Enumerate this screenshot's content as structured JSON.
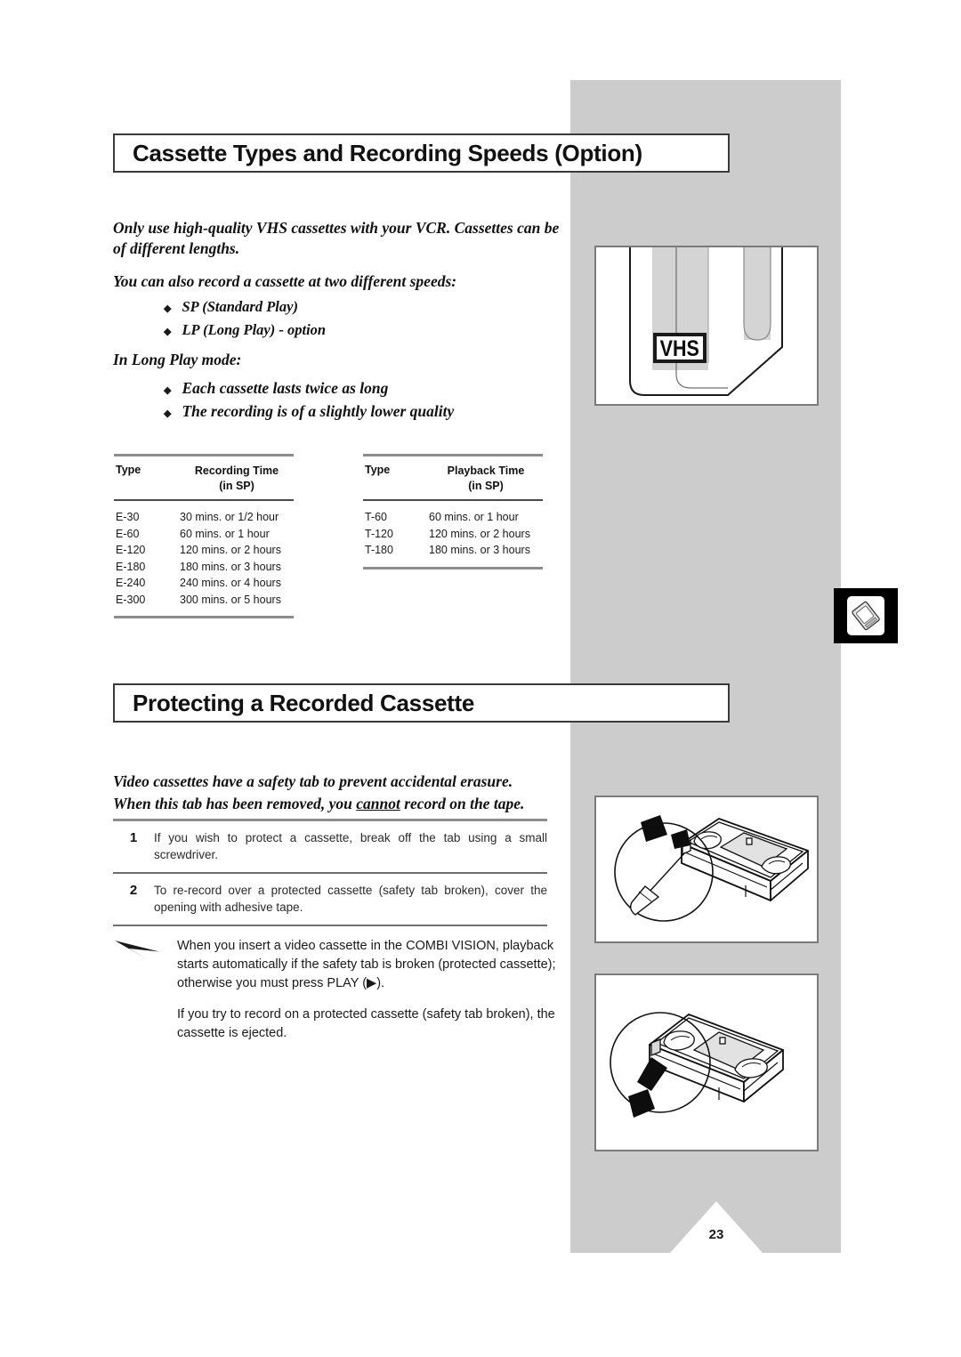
{
  "page": {
    "number": "23",
    "band_color": "#cccccc"
  },
  "sections": [
    {
      "title": "Cassette Types and Recording Speeds (Option)"
    },
    {
      "title": "Protecting a Recorded Cassette"
    }
  ],
  "cassette_types": {
    "intro_1": "Only use high-quality VHS cassettes with your VCR. Cassettes can be of different lengths.",
    "intro_2": "You can also record a cassette at two different speeds:",
    "speed_bullets": [
      "SP (Standard Play)",
      "LP (Long Play) - option"
    ],
    "lp_mode_heading": "In Long Play mode:",
    "lp_bullets": [
      "Each cassette lasts twice as long",
      "The recording is of a slightly lower quality"
    ],
    "bullet_glyph": "◆"
  },
  "tables": [
    {
      "name": "recording-time",
      "headers": {
        "type": "Type",
        "time_line1": "Recording Time",
        "time_line2": "(in SP)"
      },
      "rows": [
        {
          "type": "E-30",
          "time": "30 mins. or 1/2 hour"
        },
        {
          "type": "E-60",
          "time": "60 mins. or 1 hour"
        },
        {
          "type": "E-120",
          "time": "120 mins. or 2 hours"
        },
        {
          "type": "E-180",
          "time": "180 mins. or 3 hours"
        },
        {
          "type": "E-240",
          "time": "240 mins. or 4 hours"
        },
        {
          "type": "E-300",
          "time": "300 mins. or 5 hours"
        }
      ]
    },
    {
      "name": "playback-time",
      "headers": {
        "type": "Type",
        "time_line1": "Playback Time",
        "time_line2": "(in SP)"
      },
      "rows": [
        {
          "type": "T-60",
          "time": "60 mins. or 1 hour"
        },
        {
          "type": "T-120",
          "time": "120 mins. or 2 hours"
        },
        {
          "type": "T-180",
          "time": "180 mins. or 3 hours"
        }
      ]
    }
  ],
  "protecting": {
    "intro_line1": "Video cassettes have a safety tab to prevent accidental erasure.",
    "intro_line2_a": "When this tab has been removed, you ",
    "intro_line2_underlined": "cannot",
    "intro_line2_b": " record on the tape.",
    "steps": [
      {
        "number": "1",
        "text": "If you wish to protect a cassette, break off the tab using a small screwdriver."
      },
      {
        "number": "2",
        "text": "To re-record over a protected cassette (safety tab broken), cover the opening with adhesive tape."
      }
    ],
    "note": {
      "paragraph_1_a": "When you insert a video cassette in the COMBI VISION, playback starts automatically if the safety tab is broken (protected cassette); otherwise you must press PLAY (",
      "paragraph_1_play_glyph": "▶",
      "paragraph_1_b": ").",
      "paragraph_2": "If you try to record on a protected cassette (safety tab broken), the cassette is ejected."
    }
  },
  "illustrations": {
    "vhs_logo_label": "VHS",
    "vhs_box_name": "vhs-cassette-front-illustration",
    "break_tab_box_name": "breaking-safety-tab-illustration",
    "broken_tab_box_name": "broken-safety-tab-illustration",
    "side_icon_name": "cassette-tab-marker-icon"
  }
}
